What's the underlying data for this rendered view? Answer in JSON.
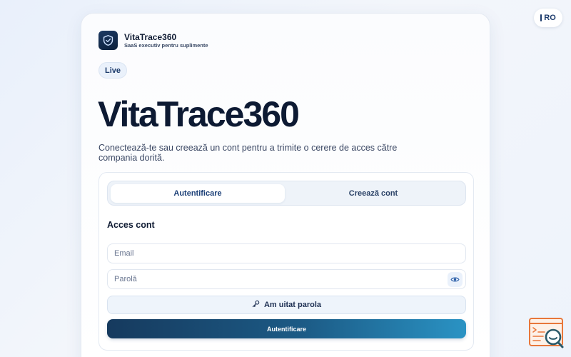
{
  "language": {
    "code": "RO"
  },
  "brand": {
    "name": "VitaTrace360",
    "tagline": "SaaS executiv pentru suplimente"
  },
  "status_badge": "Live",
  "hero": {
    "title": "VitaTrace360",
    "subtitle": "Conectează-te sau creează un cont pentru a trimite o cerere de acces către compania dorită."
  },
  "tabs": [
    {
      "label": "Autentificare",
      "active": true
    },
    {
      "label": "Creează cont",
      "active": false
    }
  ],
  "form": {
    "section_title": "Acces cont",
    "email_placeholder": "Email",
    "email_value": "",
    "password_placeholder": "Parolă",
    "password_value": "",
    "forgot_label": "Am uitat parola",
    "submit_label": "Autentificare"
  },
  "icons": {
    "logo": "shield-logo-icon",
    "eye": "eye-icon",
    "key": "key-icon",
    "help": "help-search-icon"
  },
  "colors": {
    "accent": "#1b3f77",
    "button_gradient_start": "#163a5e",
    "button_gradient_end": "#2a93c4",
    "help_widget": "#e8773a"
  }
}
